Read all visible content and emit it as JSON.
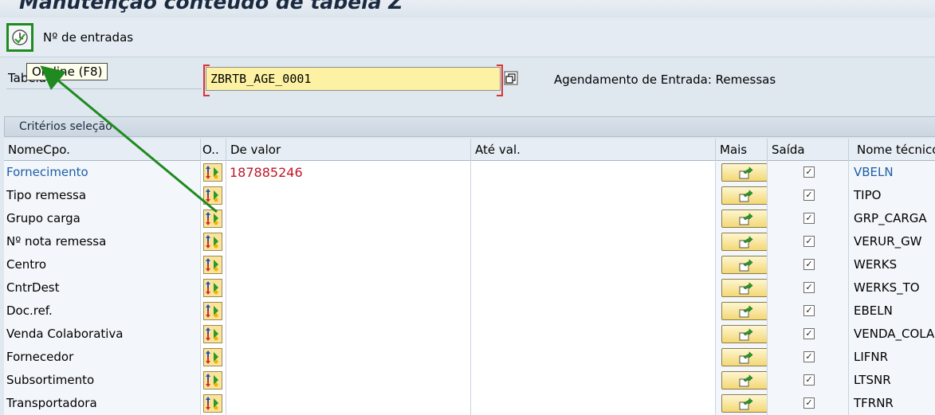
{
  "window": {
    "title": "Manutenção conteúdo de tabela Z"
  },
  "toolbar": {
    "entries_label": "Nº de entradas"
  },
  "tooltip": {
    "text": "On-line   (F8)"
  },
  "table_field": {
    "label": "Tabela",
    "value": "ZBRTB_AGE_0001",
    "description": "Agendamento de Entrada: Remessas"
  },
  "panel": {
    "title": "Critérios seleção"
  },
  "grid": {
    "headers": {
      "name": "NomeCpo.",
      "option": "O..",
      "from": "De valor",
      "to": "Até val.",
      "more": "Mais",
      "output": "Saída",
      "tech": "Nome técnico"
    },
    "rows": [
      {
        "name": "Fornecimento",
        "from": "187885246",
        "tech": "VBELN",
        "output": "✓"
      },
      {
        "name": "Tipo remessa",
        "from": "",
        "tech": "TIPO",
        "output": "✓"
      },
      {
        "name": "Grupo carga",
        "from": "",
        "tech": "GRP_CARGA",
        "output": "✓"
      },
      {
        "name": "Nº nota remessa",
        "from": "",
        "tech": "VERUR_GW",
        "output": "✓"
      },
      {
        "name": "Centro",
        "from": "",
        "tech": "WERKS",
        "output": "✓"
      },
      {
        "name": "CntrDest",
        "from": "",
        "tech": "WERKS_TO",
        "output": "✓"
      },
      {
        "name": "Doc.ref.",
        "from": "",
        "tech": "EBELN",
        "output": "✓"
      },
      {
        "name": "Venda Colaborativa",
        "from": "",
        "tech": "VENDA_COLAB",
        "output": "✓"
      },
      {
        "name": "Fornecedor",
        "from": "",
        "tech": "LIFNR",
        "output": "✓"
      },
      {
        "name": "Subsortimento",
        "from": "",
        "tech": "LTSNR",
        "output": "✓"
      },
      {
        "name": "Transportadora",
        "from": "",
        "tech": "TFRNR",
        "output": "✓"
      }
    ]
  },
  "colors": {
    "highlight_box": "#1f8a1f",
    "link_text": "#1c5fa8",
    "value_text": "#c0152a",
    "input_bg": "#fdf2a3"
  }
}
